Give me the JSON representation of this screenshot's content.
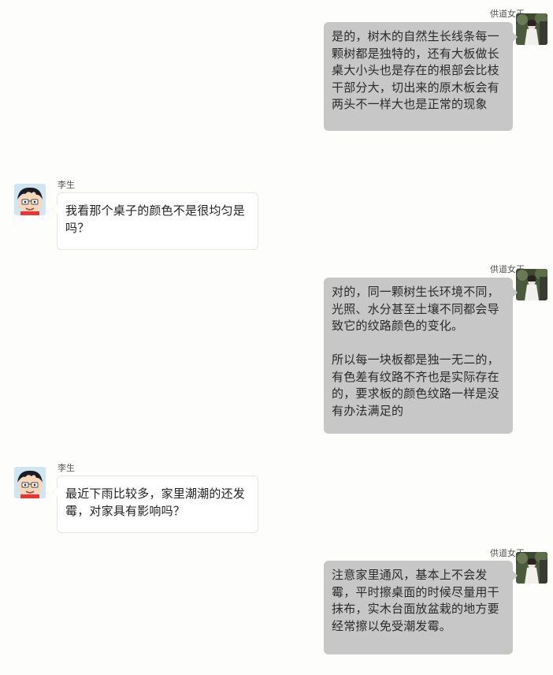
{
  "contacts": {
    "seller": {
      "name": "供道女王",
      "avatar_icon": "seller-photo-avatar"
    },
    "buyer": {
      "name": "李生",
      "avatar_icon": "cartoon-boy-avatar"
    }
  },
  "messages": [
    {
      "sender": "供道女王",
      "side": "right",
      "text": "是的，树木的自然生长线条每一颗树都是独特的，还有大板做长桌大小头也是存在的根部会比枝干部分大，切出来的原木板会有两头不一样大也是正常的现象"
    },
    {
      "sender": "李生",
      "side": "left",
      "text": "我看那个桌子的颜色不是很均匀是吗？"
    },
    {
      "sender": "供道女王",
      "side": "right",
      "text": "对的，同一颗树生长环境不同，光照、水分甚至土壤不同都会导致它的纹路颜色的变化。\n\n所以每一块板都是独一无二的，有色差有纹路不齐也是实际存在的，要求板的颜色纹路一样是没有办法满足的"
    },
    {
      "sender": "李生",
      "side": "left",
      "text": "最近下雨比较多，家里潮潮的还发霉，对家具有影响吗？"
    },
    {
      "sender": "供道女王",
      "side": "right",
      "text": "注意家里通风，基本上不会发霉，平时擦桌面的时候尽量用干抹布，实木台面放盆栽的地方要经常擦以免受潮发霉。"
    }
  ],
  "colors": {
    "background": "#fdfdfb",
    "right_bubble": "#c7c7c7",
    "left_bubble": "#ffffff"
  }
}
